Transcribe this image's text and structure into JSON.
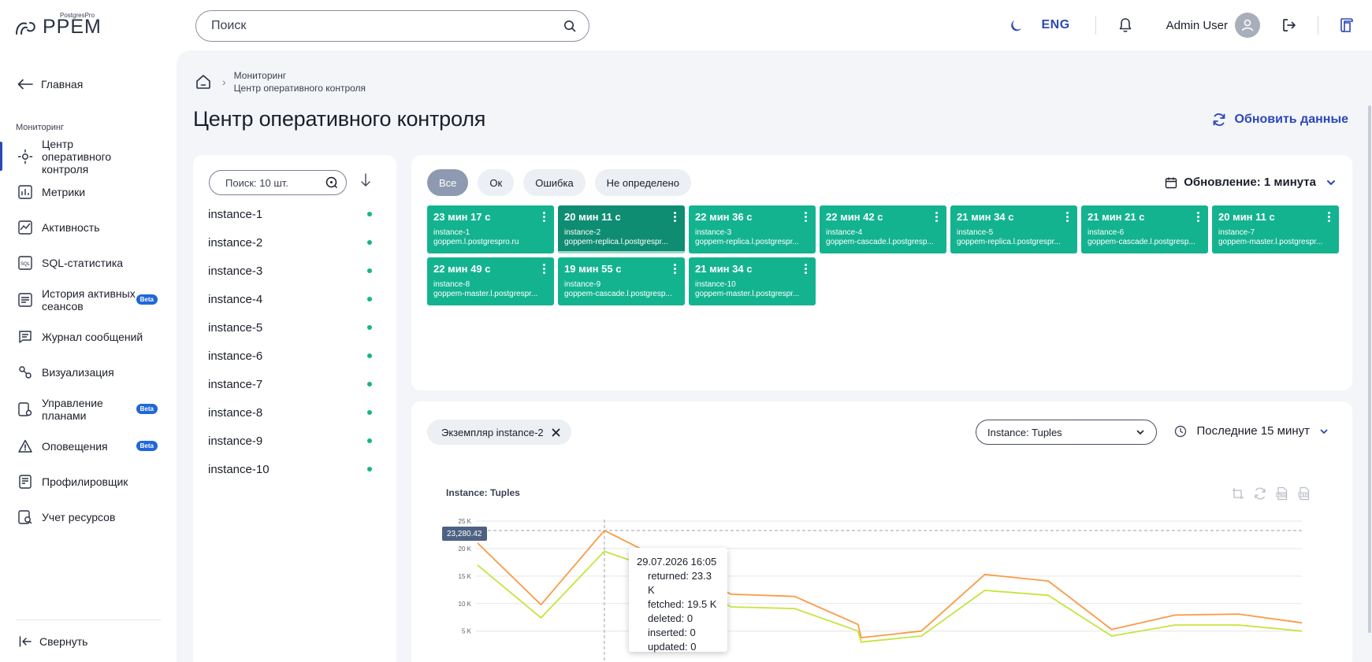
{
  "app": {
    "logo_sub": "PostgresPro",
    "logo_main": "PPEM",
    "search_placeholder": "Поиск",
    "lang": "ENG",
    "user_name": "Admin User"
  },
  "sidebar": {
    "back_label": "Главная",
    "section_label": "Мониторинг",
    "items": [
      {
        "label": "Центр оперативного контроля",
        "icon": "monitor-icon",
        "active": true,
        "beta": false
      },
      {
        "label": "Метрики",
        "icon": "metrics-icon",
        "active": false,
        "beta": false
      },
      {
        "label": "Активность",
        "icon": "activity-icon",
        "active": false,
        "beta": false
      },
      {
        "label": "SQL-статистика",
        "icon": "sql-icon",
        "active": false,
        "beta": false
      },
      {
        "label": "История активных сеансов",
        "icon": "history-icon",
        "active": false,
        "beta": true
      },
      {
        "label": "Журнал сообщений",
        "icon": "log-icon",
        "active": false,
        "beta": false
      },
      {
        "label": "Визуализация",
        "icon": "visualization-icon",
        "active": false,
        "beta": false
      },
      {
        "label": "Управление планами",
        "icon": "plans-icon",
        "active": false,
        "beta": true
      },
      {
        "label": "Оповещения",
        "icon": "alert-icon",
        "active": false,
        "beta": true
      },
      {
        "label": "Профилировщик",
        "icon": "profiler-icon",
        "active": false,
        "beta": false
      },
      {
        "label": "Учет ресурсов",
        "icon": "resources-icon",
        "active": false,
        "beta": false
      }
    ],
    "beta_label": "Beta",
    "collapse_label": "Свернуть"
  },
  "main": {
    "breadcrumb": [
      "Мониторинг",
      "Центр оперативного контроля"
    ],
    "title": "Центр оперативного контроля",
    "refresh_label": "Обновить данные"
  },
  "instance_list": {
    "search_placeholder": "Поиск: 10 шт.",
    "items": [
      "instance-1",
      "instance-2",
      "instance-3",
      "instance-4",
      "instance-5",
      "instance-6",
      "instance-7",
      "instance-8",
      "instance-9",
      "instance-10"
    ],
    "status_color": "#18b38a"
  },
  "tiles_panel": {
    "filters": [
      {
        "label": "Все",
        "active": true
      },
      {
        "label": "Ок",
        "active": false
      },
      {
        "label": "Ошибка",
        "active": false
      },
      {
        "label": "Не определено",
        "active": false
      }
    ],
    "update_label": "Обновление: 1 минута",
    "tiles": [
      {
        "time": "23 мин 17 с",
        "name": "instance-1",
        "host": "goppem.l.postgrespro.ru",
        "selected": false
      },
      {
        "time": "20 мин 11 с",
        "name": "instance-2",
        "host": "goppem-replica.l.postgrespr...",
        "selected": true
      },
      {
        "time": "22 мин 36 с",
        "name": "instance-3",
        "host": "goppem-replica.l.postgrespr...",
        "selected": false
      },
      {
        "time": "22 мин 42 с",
        "name": "instance-4",
        "host": "goppem-cascade.l.postgresp...",
        "selected": false
      },
      {
        "time": "21 мин 34 с",
        "name": "instance-5",
        "host": "goppem-replica.l.postgrespr...",
        "selected": false
      },
      {
        "time": "21 мин 21 с",
        "name": "instance-6",
        "host": "goppem-cascade.l.postgresp...",
        "selected": false
      },
      {
        "time": "20 мин 11 с",
        "name": "instance-7",
        "host": "goppem-master.l.postgrespr...",
        "selected": false
      },
      {
        "time": "22 мин 49 с",
        "name": "instance-8",
        "host": "goppem-master.l.postgrespr...",
        "selected": false
      },
      {
        "time": "19 мин 55 с",
        "name": "instance-9",
        "host": "goppem-cascade.l.postgresp...",
        "selected": false
      },
      {
        "time": "21 мин 34 с",
        "name": "instance-10",
        "host": "goppem-master.l.postgrespr...",
        "selected": false
      }
    ],
    "tile_color": "#14b390",
    "tile_selected_color": "#0f8d72"
  },
  "chart_panel": {
    "instance_chip": "Экземпляр instance-2",
    "metric_select": "Instance: Tuples",
    "time_range": "Последние 15 минут",
    "tooltip": {
      "date": "29.07.2026 16:05",
      "rows": [
        "returned: 23.3 K",
        "fetched: 19.5 K",
        "deleted: 0",
        "inserted: 0",
        "updated: 0"
      ]
    },
    "crosshair_value": "23,280.42"
  },
  "chart_data": {
    "type": "line",
    "title": "Instance: Tuples",
    "y_ticks": [
      "25 K",
      "20 K",
      "15 K",
      "10 K",
      "5 K"
    ],
    "ylim": [
      0,
      25000
    ],
    "x_index": [
      0,
      1,
      2,
      3,
      4,
      5,
      6,
      6.05,
      7,
      8,
      9,
      10,
      11,
      12,
      13
    ],
    "series": [
      {
        "name": "returned",
        "color": "#fb9a45",
        "values": [
          21000,
          9800,
          23300,
          17500,
          11700,
          11300,
          6200,
          3800,
          5000,
          15300,
          14100,
          5300,
          7900,
          8100,
          6500
        ]
      },
      {
        "name": "fetched",
        "color": "#c4e53c",
        "values": [
          17000,
          7400,
          19500,
          15500,
          9400,
          9100,
          5000,
          3000,
          4100,
          12400,
          11500,
          4100,
          6100,
          6100,
          5000
        ]
      }
    ],
    "grid": true
  }
}
